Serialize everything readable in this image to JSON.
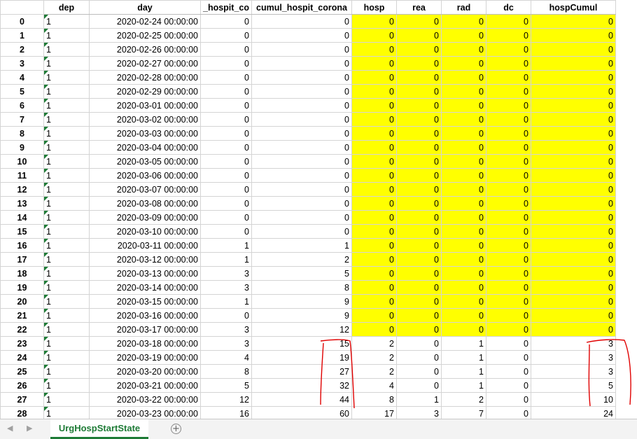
{
  "columns": [
    "dep",
    "day",
    "_hospit_co",
    "cumul_hospit_corona",
    "hosp",
    "rea",
    "rad",
    "dc",
    "hospCumul"
  ],
  "rows": [
    {
      "idx": "0",
      "dep": "1",
      "day": "2020-02-24 00:00:00",
      "hc": "0",
      "cum": "0",
      "hosp": "0",
      "rea": "0",
      "rad": "0",
      "dc": "0",
      "hcum": "0",
      "hl": true
    },
    {
      "idx": "1",
      "dep": "1",
      "day": "2020-02-25 00:00:00",
      "hc": "0",
      "cum": "0",
      "hosp": "0",
      "rea": "0",
      "rad": "0",
      "dc": "0",
      "hcum": "0",
      "hl": true
    },
    {
      "idx": "2",
      "dep": "1",
      "day": "2020-02-26 00:00:00",
      "hc": "0",
      "cum": "0",
      "hosp": "0",
      "rea": "0",
      "rad": "0",
      "dc": "0",
      "hcum": "0",
      "hl": true
    },
    {
      "idx": "3",
      "dep": "1",
      "day": "2020-02-27 00:00:00",
      "hc": "0",
      "cum": "0",
      "hosp": "0",
      "rea": "0",
      "rad": "0",
      "dc": "0",
      "hcum": "0",
      "hl": true
    },
    {
      "idx": "4",
      "dep": "1",
      "day": "2020-02-28 00:00:00",
      "hc": "0",
      "cum": "0",
      "hosp": "0",
      "rea": "0",
      "rad": "0",
      "dc": "0",
      "hcum": "0",
      "hl": true
    },
    {
      "idx": "5",
      "dep": "1",
      "day": "2020-02-29 00:00:00",
      "hc": "0",
      "cum": "0",
      "hosp": "0",
      "rea": "0",
      "rad": "0",
      "dc": "0",
      "hcum": "0",
      "hl": true
    },
    {
      "idx": "6",
      "dep": "1",
      "day": "2020-03-01 00:00:00",
      "hc": "0",
      "cum": "0",
      "hosp": "0",
      "rea": "0",
      "rad": "0",
      "dc": "0",
      "hcum": "0",
      "hl": true
    },
    {
      "idx": "7",
      "dep": "1",
      "day": "2020-03-02 00:00:00",
      "hc": "0",
      "cum": "0",
      "hosp": "0",
      "rea": "0",
      "rad": "0",
      "dc": "0",
      "hcum": "0",
      "hl": true
    },
    {
      "idx": "8",
      "dep": "1",
      "day": "2020-03-03 00:00:00",
      "hc": "0",
      "cum": "0",
      "hosp": "0",
      "rea": "0",
      "rad": "0",
      "dc": "0",
      "hcum": "0",
      "hl": true
    },
    {
      "idx": "9",
      "dep": "1",
      "day": "2020-03-04 00:00:00",
      "hc": "0",
      "cum": "0",
      "hosp": "0",
      "rea": "0",
      "rad": "0",
      "dc": "0",
      "hcum": "0",
      "hl": true
    },
    {
      "idx": "10",
      "dep": "1",
      "day": "2020-03-05 00:00:00",
      "hc": "0",
      "cum": "0",
      "hosp": "0",
      "rea": "0",
      "rad": "0",
      "dc": "0",
      "hcum": "0",
      "hl": true
    },
    {
      "idx": "11",
      "dep": "1",
      "day": "2020-03-06 00:00:00",
      "hc": "0",
      "cum": "0",
      "hosp": "0",
      "rea": "0",
      "rad": "0",
      "dc": "0",
      "hcum": "0",
      "hl": true
    },
    {
      "idx": "12",
      "dep": "1",
      "day": "2020-03-07 00:00:00",
      "hc": "0",
      "cum": "0",
      "hosp": "0",
      "rea": "0",
      "rad": "0",
      "dc": "0",
      "hcum": "0",
      "hl": true
    },
    {
      "idx": "13",
      "dep": "1",
      "day": "2020-03-08 00:00:00",
      "hc": "0",
      "cum": "0",
      "hosp": "0",
      "rea": "0",
      "rad": "0",
      "dc": "0",
      "hcum": "0",
      "hl": true
    },
    {
      "idx": "14",
      "dep": "1",
      "day": "2020-03-09 00:00:00",
      "hc": "0",
      "cum": "0",
      "hosp": "0",
      "rea": "0",
      "rad": "0",
      "dc": "0",
      "hcum": "0",
      "hl": true
    },
    {
      "idx": "15",
      "dep": "1",
      "day": "2020-03-10 00:00:00",
      "hc": "0",
      "cum": "0",
      "hosp": "0",
      "rea": "0",
      "rad": "0",
      "dc": "0",
      "hcum": "0",
      "hl": true
    },
    {
      "idx": "16",
      "dep": "1",
      "day": "2020-03-11 00:00:00",
      "hc": "1",
      "cum": "1",
      "hosp": "0",
      "rea": "0",
      "rad": "0",
      "dc": "0",
      "hcum": "0",
      "hl": true
    },
    {
      "idx": "17",
      "dep": "1",
      "day": "2020-03-12 00:00:00",
      "hc": "1",
      "cum": "2",
      "hosp": "0",
      "rea": "0",
      "rad": "0",
      "dc": "0",
      "hcum": "0",
      "hl": true
    },
    {
      "idx": "18",
      "dep": "1",
      "day": "2020-03-13 00:00:00",
      "hc": "3",
      "cum": "5",
      "hosp": "0",
      "rea": "0",
      "rad": "0",
      "dc": "0",
      "hcum": "0",
      "hl": true
    },
    {
      "idx": "19",
      "dep": "1",
      "day": "2020-03-14 00:00:00",
      "hc": "3",
      "cum": "8",
      "hosp": "0",
      "rea": "0",
      "rad": "0",
      "dc": "0",
      "hcum": "0",
      "hl": true
    },
    {
      "idx": "20",
      "dep": "1",
      "day": "2020-03-15 00:00:00",
      "hc": "1",
      "cum": "9",
      "hosp": "0",
      "rea": "0",
      "rad": "0",
      "dc": "0",
      "hcum": "0",
      "hl": true
    },
    {
      "idx": "21",
      "dep": "1",
      "day": "2020-03-16 00:00:00",
      "hc": "0",
      "cum": "9",
      "hosp": "0",
      "rea": "0",
      "rad": "0",
      "dc": "0",
      "hcum": "0",
      "hl": true
    },
    {
      "idx": "22",
      "dep": "1",
      "day": "2020-03-17 00:00:00",
      "hc": "3",
      "cum": "12",
      "hosp": "0",
      "rea": "0",
      "rad": "0",
      "dc": "0",
      "hcum": "0",
      "hl": true
    },
    {
      "idx": "23",
      "dep": "1",
      "day": "2020-03-18 00:00:00",
      "hc": "3",
      "cum": "15",
      "hosp": "2",
      "rea": "0",
      "rad": "1",
      "dc": "0",
      "hcum": "3",
      "hl": false
    },
    {
      "idx": "24",
      "dep": "1",
      "day": "2020-03-19 00:00:00",
      "hc": "4",
      "cum": "19",
      "hosp": "2",
      "rea": "0",
      "rad": "1",
      "dc": "0",
      "hcum": "3",
      "hl": false
    },
    {
      "idx": "25",
      "dep": "1",
      "day": "2020-03-20 00:00:00",
      "hc": "8",
      "cum": "27",
      "hosp": "2",
      "rea": "0",
      "rad": "1",
      "dc": "0",
      "hcum": "3",
      "hl": false
    },
    {
      "idx": "26",
      "dep": "1",
      "day": "2020-03-21 00:00:00",
      "hc": "5",
      "cum": "32",
      "hosp": "4",
      "rea": "0",
      "rad": "1",
      "dc": "0",
      "hcum": "5",
      "hl": false
    },
    {
      "idx": "27",
      "dep": "1",
      "day": "2020-03-22 00:00:00",
      "hc": "12",
      "cum": "44",
      "hosp": "8",
      "rea": "1",
      "rad": "2",
      "dc": "0",
      "hcum": "10",
      "hl": false
    },
    {
      "idx": "28",
      "dep": "1",
      "day": "2020-03-23 00:00:00",
      "hc": "16",
      "cum": "60",
      "hosp": "17",
      "rea": "3",
      "rad": "7",
      "dc": "0",
      "hcum": "24",
      "hl": false
    }
  ],
  "tabs": {
    "sheet_name": "UrgHospStartState",
    "prev_glyph": "◀",
    "next_glyph": "▶",
    "add_glyph": "+"
  },
  "colors": {
    "highlight": "#ffff00",
    "annotation": "#e00000",
    "accent": "#1e7b36"
  }
}
